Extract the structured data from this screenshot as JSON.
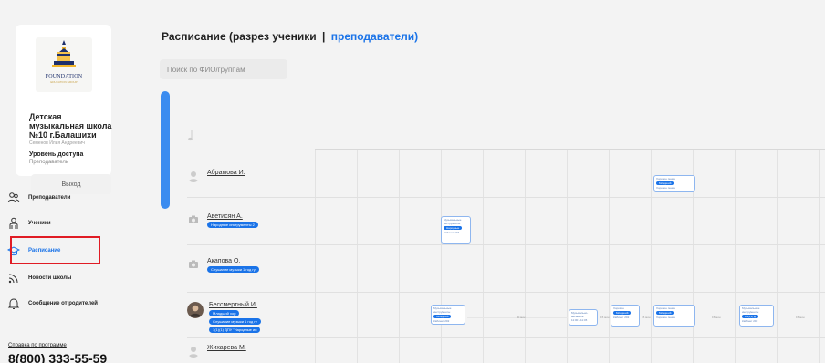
{
  "sidebar": {
    "logo_text": "FOUNDATION",
    "logo_sub": "EDUCATION GROUP",
    "school_name": "Детская музыкальная школа №10 г.Балашихи",
    "person": "Семенов Илья Андреевич",
    "access_title": "Уровень доступа",
    "access_value": "Преподаватель",
    "logout_label": "Выход",
    "nav": [
      {
        "label": "Преподаватели",
        "icon": "teachers-icon"
      },
      {
        "label": "Ученики",
        "icon": "students-icon"
      },
      {
        "label": "Расписание",
        "icon": "schedule-icon"
      },
      {
        "label": "Новости школы",
        "icon": "news-icon"
      },
      {
        "label": "Сообщение от родителей",
        "icon": "bell-icon"
      }
    ],
    "help_link": "Справка по программе",
    "phone": "8(800) 333-55-59"
  },
  "main": {
    "title_prefix": "Расписание (разрез ученики",
    "title_sep": "|",
    "title_link": "преподаватели)",
    "search_placeholder": "Поиск по ФИО/группам"
  },
  "students": [
    {
      "name": "Абрамова И.",
      "tags": []
    },
    {
      "name": "Аветисян А.",
      "tags": [
        "Народные инструменты 2"
      ]
    },
    {
      "name": "Акапова О.",
      "tags": [
        "Слушание музыки 1 год гу"
      ]
    },
    {
      "name": "Бессмертный И.",
      "tags": [
        "Младший хор",
        "Слушание музыки 1 год гу",
        "1(1)(1) ДПУ \"Народные ин"
      ]
    },
    {
      "name": "Жихарева М.",
      "tags": []
    }
  ],
  "lessons": [
    {
      "title": "Хоровое пение",
      "pill": "Младший",
      "meta": "Хоровое пение"
    },
    {
      "title": "Музыкальные инструменты",
      "pill": "Народные",
      "meta": "Кабинет 104"
    },
    {
      "title": "Музыкальные инструменты",
      "pill": "Младший",
      "meta": "Кабинет 202"
    },
    {
      "title": "Музыкально-ансамбль",
      "pill": "",
      "meta": "11:00 - 11:45"
    },
    {
      "title": "Хоровое",
      "pill": "Младший",
      "meta": "Кабинет 202"
    },
    {
      "title": "Хоровое пение",
      "pill": "Младший",
      "meta": "Хоровое пение"
    },
    {
      "title": "Музыкальные инструменты",
      "pill": "1(1)(1) Д",
      "meta": "Кабинет 202"
    }
  ],
  "gaps": [
    "30 мин",
    "15 мин",
    "15 мин",
    "15 мин",
    "15 мин"
  ],
  "colors": {
    "accent": "#1a73e8",
    "highlight": "#e01b24"
  }
}
